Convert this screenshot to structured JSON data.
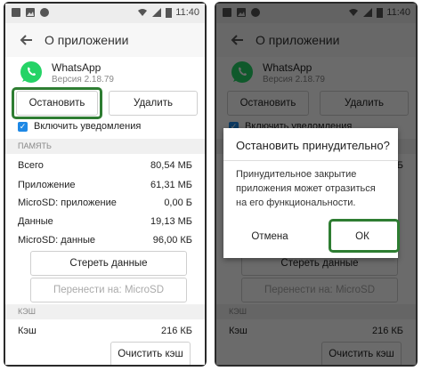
{
  "status": {
    "time": "11:40"
  },
  "header": {
    "title": "О приложении"
  },
  "app": {
    "name": "WhatsApp",
    "version": "Версия 2.18.79"
  },
  "actions": {
    "stop_label": "Остановить",
    "delete_label": "Удалить"
  },
  "notifications": {
    "label": "Включить уведомления",
    "checked": true
  },
  "memory": {
    "section": "ПАМЯТЬ",
    "rows": [
      {
        "label": "Всего",
        "value": "80,54 МБ"
      },
      {
        "label": "Приложение",
        "value": "61,31 МБ"
      },
      {
        "label": "MicroSD: приложение",
        "value": "0,00 Б"
      },
      {
        "label": "Данные",
        "value": "19,13 МБ"
      },
      {
        "label": "MicroSD: данные",
        "value": "96,00 КБ"
      }
    ],
    "clear_data_label": "Стереть данные",
    "move_label": "Перенести на: MicroSD"
  },
  "cache": {
    "section": "КЭШ",
    "label": "Кэш",
    "value": "216 КБ",
    "clear_label": "Очистить кэш"
  },
  "dialog": {
    "title": "Остановить принудительно?",
    "message": "Принудительное закрытие приложения может отразиться на его функциональности.",
    "cancel_label": "Отмена",
    "ok_label": "ОК"
  },
  "colors": {
    "highlight": "#2e7d32",
    "checkbox": "#1e88e5",
    "whatsapp": "#25d366"
  }
}
